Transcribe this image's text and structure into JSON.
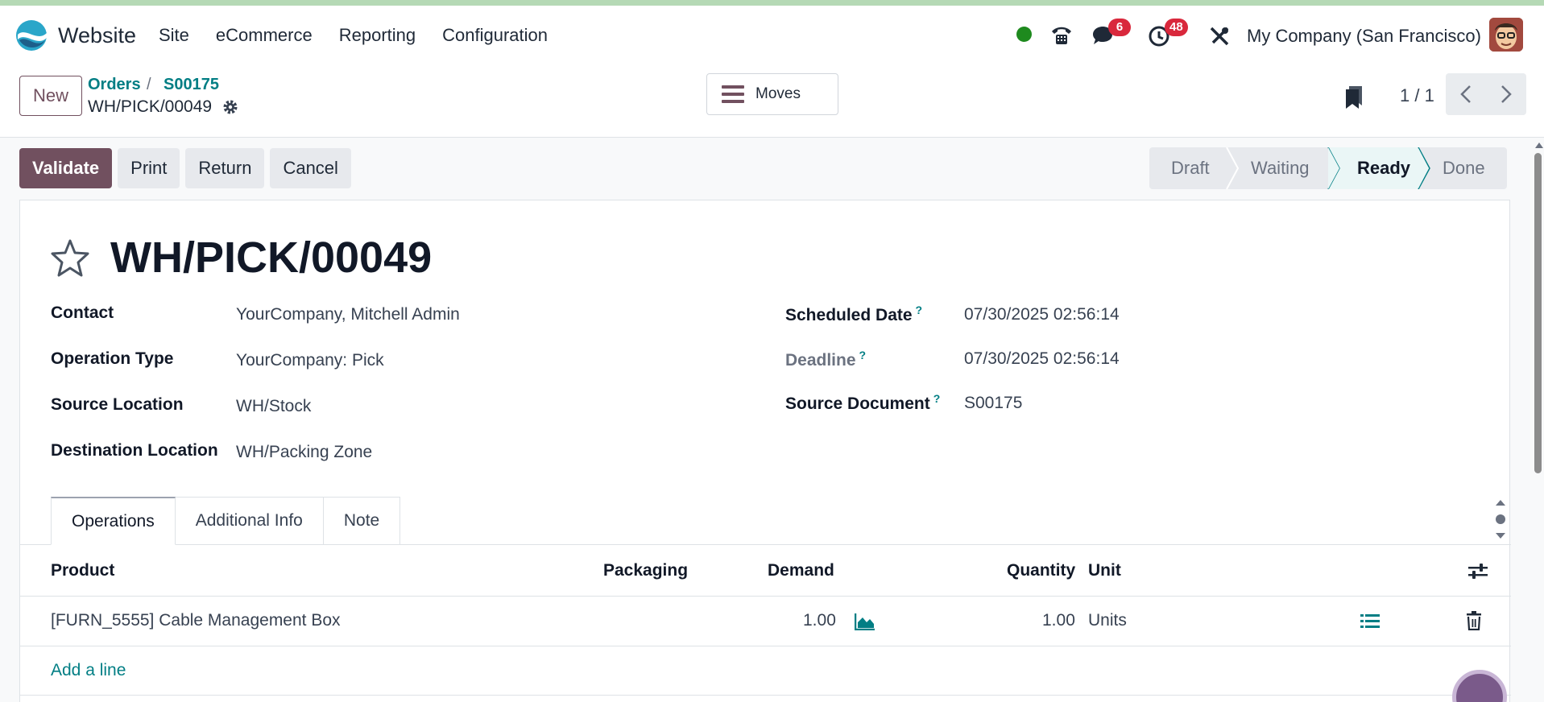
{
  "navbar": {
    "app_name": "Website",
    "menu": [
      "Site",
      "eCommerce",
      "Reporting",
      "Configuration"
    ],
    "chat_badge": "6",
    "activity_badge": "48",
    "company": "My Company (San Francisco)",
    "status_color": "#1e8a1e"
  },
  "control": {
    "new_label": "New",
    "breadcrumb": [
      "Orders",
      "S00175"
    ],
    "breadcrumb_sep": "/",
    "record_name": "WH/PICK/00049",
    "moves_label": "Moves",
    "pager": "1 / 1"
  },
  "actions": {
    "validate": "Validate",
    "print": "Print",
    "return": "Return",
    "cancel": "Cancel"
  },
  "status": {
    "stages": [
      "Draft",
      "Waiting",
      "Ready",
      "Done"
    ],
    "current": "Ready"
  },
  "form": {
    "title": "WH/PICK/00049",
    "contact_label": "Contact",
    "contact_value": "YourCompany, Mitchell Admin",
    "operation_type_label": "Operation Type",
    "operation_type_value": "YourCompany: Pick",
    "source_location_label": "Source Location",
    "source_location_value": "WH/Stock",
    "destination_location_label": "Destination Location",
    "destination_location_value": "WH/Packing Zone",
    "scheduled_date_label": "Scheduled Date",
    "scheduled_date_value": "07/30/2025 02:56:14",
    "deadline_label": "Deadline",
    "deadline_value": "07/30/2025 02:56:14",
    "source_document_label": "Source Document",
    "source_document_value": "S00175",
    "help_mark": "?"
  },
  "tabs": [
    "Operations",
    "Additional Info",
    "Note"
  ],
  "table": {
    "columns": [
      "Product",
      "Packaging",
      "Demand",
      "Quantity",
      "Unit"
    ],
    "rows": [
      {
        "product": "[FURN_5555] Cable Management Box",
        "packaging": "",
        "demand": "1.00",
        "quantity": "1.00",
        "unit": "Units"
      }
    ],
    "add_line": "Add a line"
  },
  "colors": {
    "brand": "#71505f",
    "link": "#017e84",
    "badge": "#d9283c"
  }
}
